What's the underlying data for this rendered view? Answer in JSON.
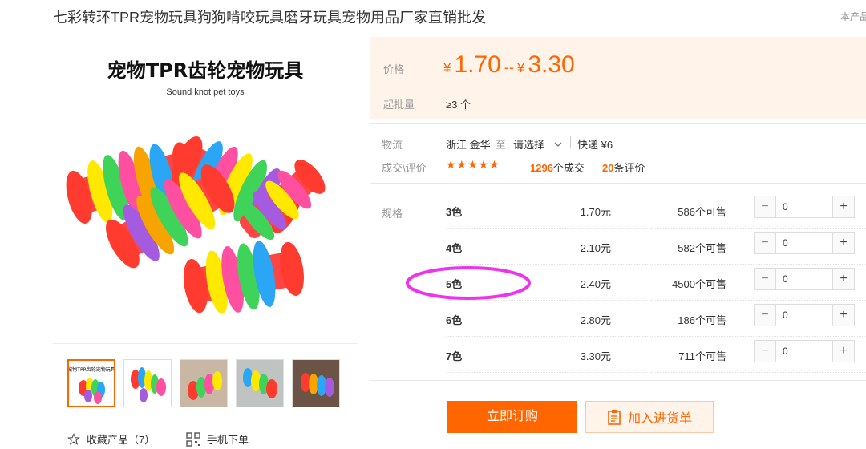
{
  "title": "七彩转环TPR宠物玩具狗狗啃咬玩具磨牙玩具宠物用品厂家直销批发",
  "title_right": "本产品",
  "image": {
    "headline": "宠物TPR齿轮宠物玩具",
    "subline": "Sound knot pet toys"
  },
  "thumb_caption": "宠物TPR齿轮宠物玩具",
  "actions": {
    "favorite": "收藏产品（7）",
    "mobile": "手机下单"
  },
  "price": {
    "label": "价格",
    "currency": "¥",
    "low": "1.70",
    "sep": "--",
    "high": "3.30"
  },
  "moq": {
    "label": "起批量",
    "value": "≥3 个"
  },
  "logistics": {
    "label": "物流",
    "from": "浙江 金华",
    "to": "至",
    "select": "请选择",
    "express": "快递 ¥6"
  },
  "deals": {
    "label": "成交\\评价",
    "stars": "★★★★★",
    "rating": 4.5,
    "count": "1296",
    "count_suffix": "个成交",
    "reviews": "20",
    "reviews_suffix": "条评价"
  },
  "spec_label": "规格",
  "specs": [
    {
      "name": "3色",
      "price": "1.70元",
      "stock": "586个可售",
      "qty": "0"
    },
    {
      "name": "4色",
      "price": "2.10元",
      "stock": "582个可售",
      "qty": "0"
    },
    {
      "name": "5色",
      "price": "2.40元",
      "stock": "4500个可售",
      "qty": "0"
    },
    {
      "name": "6色",
      "price": "2.80元",
      "stock": "186个可售",
      "qty": "0"
    },
    {
      "name": "7色",
      "price": "3.30元",
      "stock": "711个可售",
      "qty": "0"
    }
  ],
  "stepper": {
    "minus": "−",
    "plus": "+"
  },
  "buttons": {
    "order": "立即订购",
    "cart": "加入进货单"
  },
  "colors": {
    "accent": "#ff6600",
    "highlight": "#ee33ee",
    "price_bg": "#fff3ea"
  }
}
